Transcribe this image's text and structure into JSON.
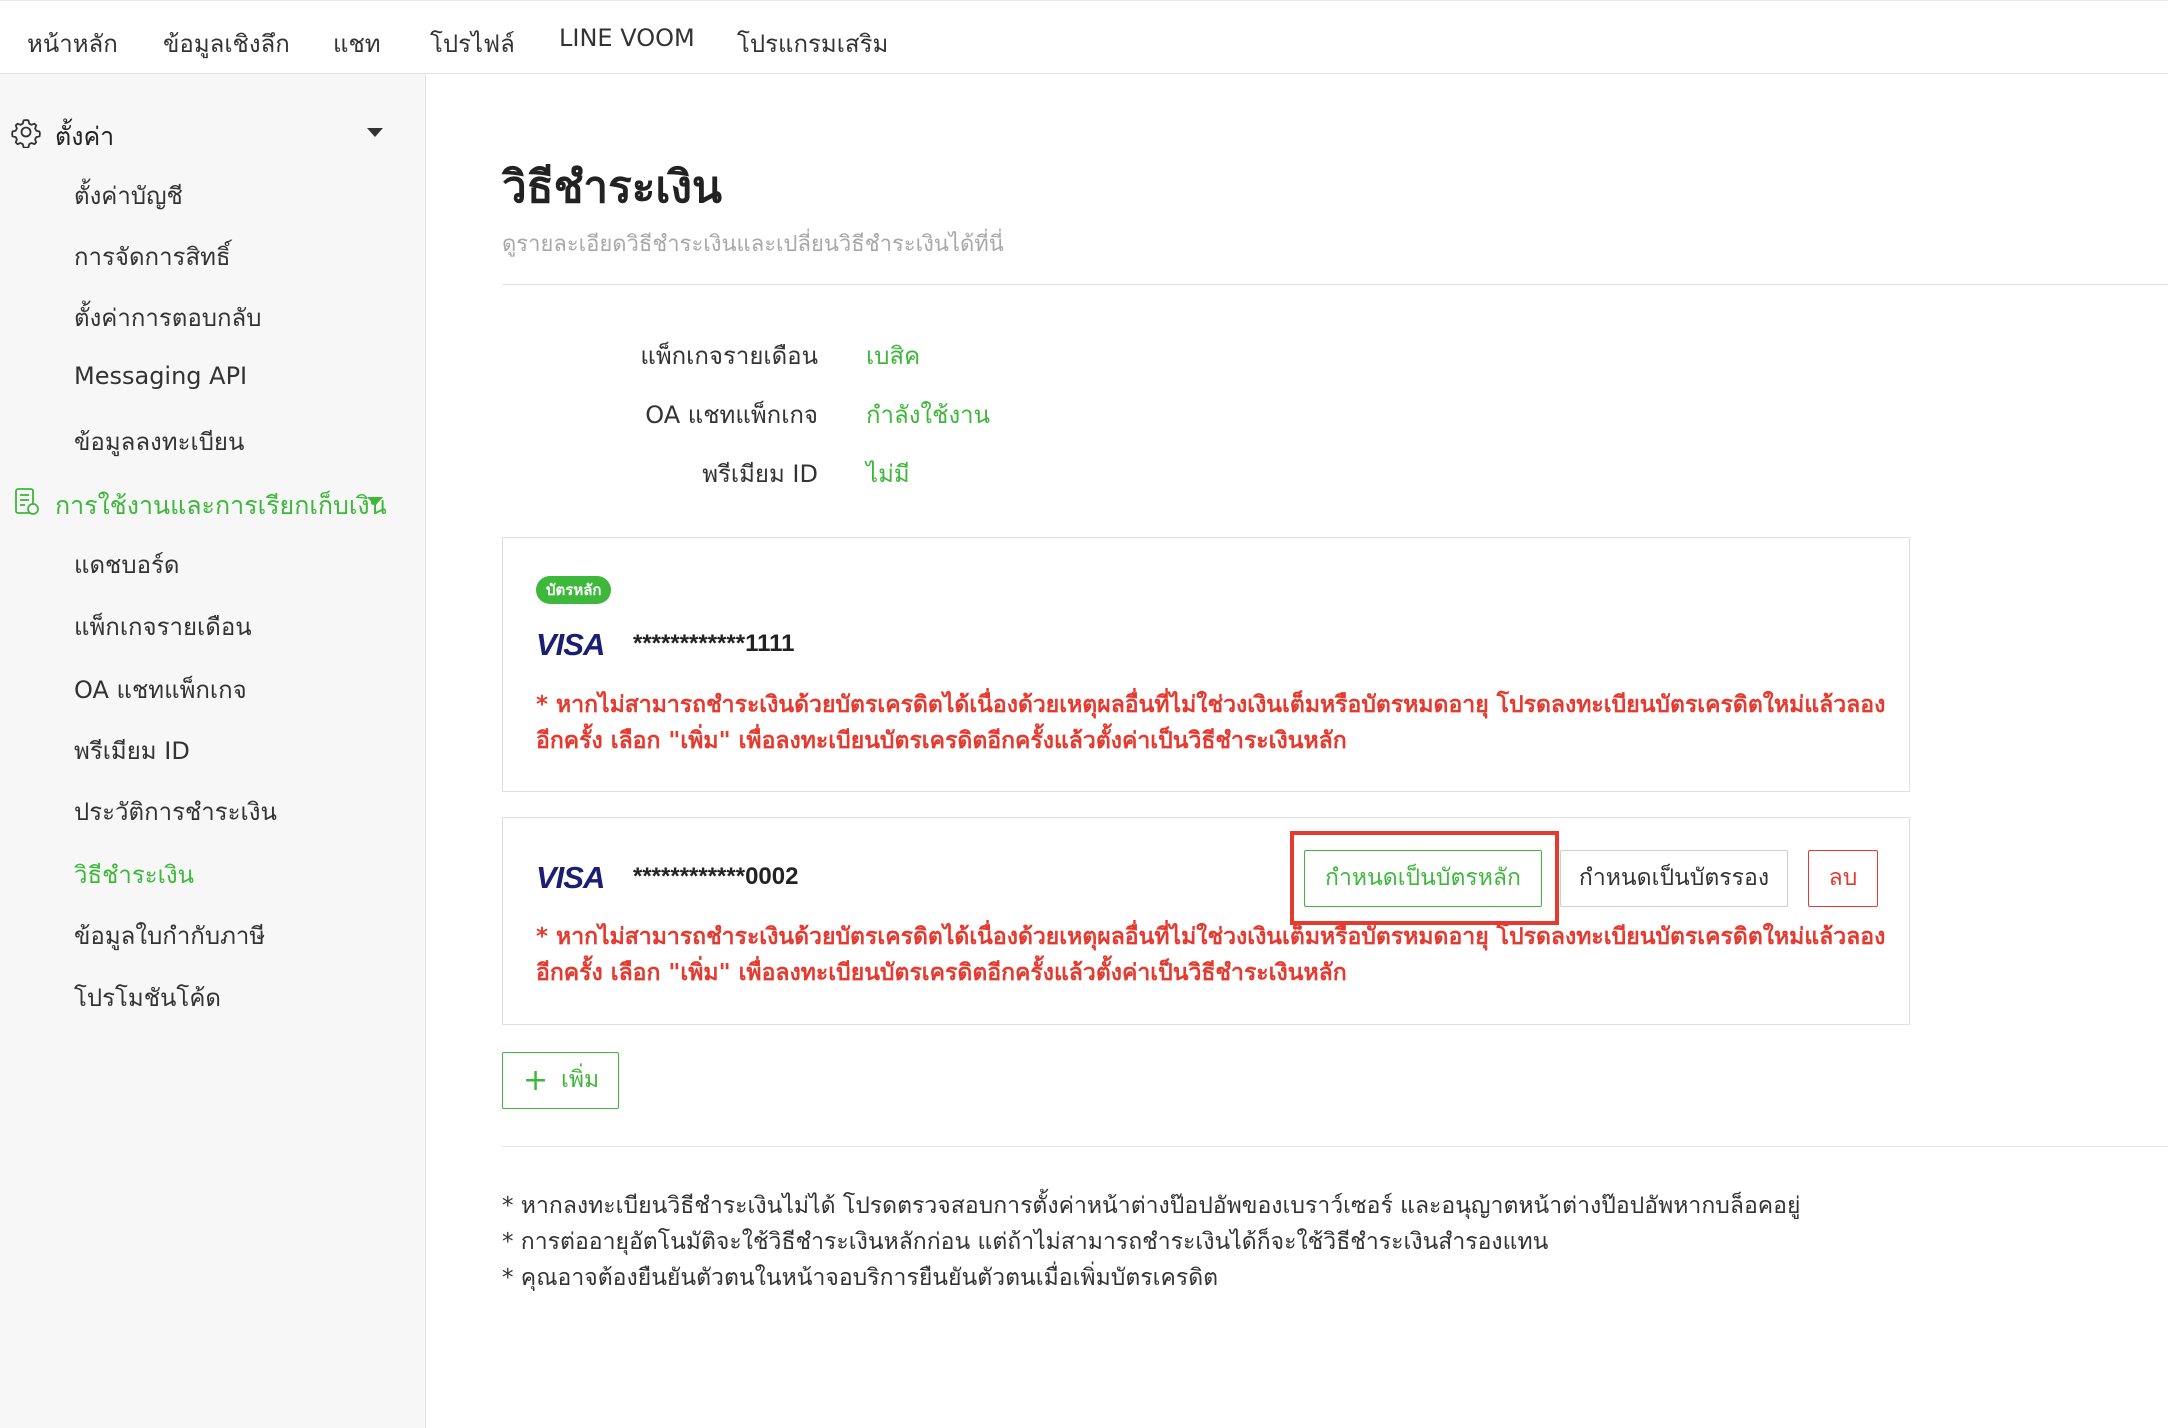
{
  "topnav": {
    "items": [
      "หน้าหลัก",
      "ข้อมูลเชิงลึก",
      "แชท",
      "โปรไฟล์",
      "LINE VOOM",
      "โปรแกรมเสริม"
    ]
  },
  "sidebar": {
    "settings": {
      "label": "ตั้งค่า",
      "items": [
        "ตั้งค่าบัญชี",
        "การจัดการสิทธิ์",
        "ตั้งค่าการตอบกลับ",
        "Messaging API",
        "ข้อมูลลงทะเบียน"
      ]
    },
    "billing": {
      "label": "การใช้งานและการเรียกเก็บเงิน",
      "items": [
        "แดชบอร์ด",
        "แพ็กเกจรายเดือน",
        "OA แชทแพ็กเกจ",
        "พรีเมียม ID",
        "ประวัติการชำระเงิน",
        "วิธีชำระเงิน",
        "ข้อมูลใบกำกับภาษี",
        "โปรโมชันโค้ด"
      ],
      "active_index": 5
    }
  },
  "main": {
    "title": "วิธีชำระเงิน",
    "subtitle": "ดูรายละเอียดวิธีชำระเงินและเปลี่ยนวิธีชำระเงินได้ที่นี่",
    "info": [
      {
        "label": "แพ็กเกจรายเดือน",
        "value": "เบสิค"
      },
      {
        "label": "OA แชทแพ็กเกจ",
        "value": "กำลังใช้งาน"
      },
      {
        "label": "พรีเมียม ID",
        "value": "ไม่มี"
      }
    ],
    "cards": [
      {
        "badge": "บัตรหลัก",
        "brand": "VISA",
        "number": "************1111",
        "warning_line1": "* หากไม่สามารถชำระเงินด้วยบัตรเครดิตได้เนื่องด้วยเหตุผลอื่นที่ไม่ใช่วงเงินเต็มหรือบัตรหมดอายุ โปรดลงทะเบียนบัตรเครดิตใหม่แล้วลอง",
        "warning_line2": "อีกครั้ง เลือก \"เพิ่ม\" เพื่อลงทะเบียนบัตรเครดิตอีกครั้งแล้วตั้งค่าเป็นวิธีชำระเงินหลัก"
      },
      {
        "brand": "VISA",
        "number": "************0002",
        "set_primary_label": "กำหนดเป็นบัตรหลัก",
        "set_secondary_label": "กำหนดเป็นบัตรรอง",
        "delete_label": "ลบ",
        "warning_line1": "* หากไม่สามารถชำระเงินด้วยบัตรเครดิตได้เนื่องด้วยเหตุผลอื่นที่ไม่ใช่วงเงินเต็มหรือบัตรหมดอายุ โปรดลงทะเบียนบัตรเครดิตใหม่แล้วลอง",
        "warning_line2": "อีกครั้ง เลือก \"เพิ่ม\" เพื่อลงทะเบียนบัตรเครดิตอีกครั้งแล้วตั้งค่าเป็นวิธีชำระเงินหลัก"
      }
    ],
    "add_label": "เพิ่ม",
    "notes": [
      "* หากลงทะเบียนวิธีชำระเงินไม่ได้ โปรดตรวจสอบการตั้งค่าหน้าต่างป๊อปอัพของเบราว์เซอร์ และอนุญาตหน้าต่างป๊อปอัพหากบล็อคอยู่",
      "* การต่ออายุอัตโนมัติจะใช้วิธีชำระเงินหลักก่อน แต่ถ้าไม่สามารถชำระเงินได้ก็จะใช้วิธีชำระเงินสำรองแทน",
      "* คุณอาจต้องยืนยันตัวตนในหน้าจอบริการยืนยันตัวตนเมื่อเพิ่มบัตรเครดิต"
    ]
  },
  "colors": {
    "accent_green": "#3db83a",
    "warning_red": "#e53a2f",
    "visa_blue": "#1a1f71"
  }
}
